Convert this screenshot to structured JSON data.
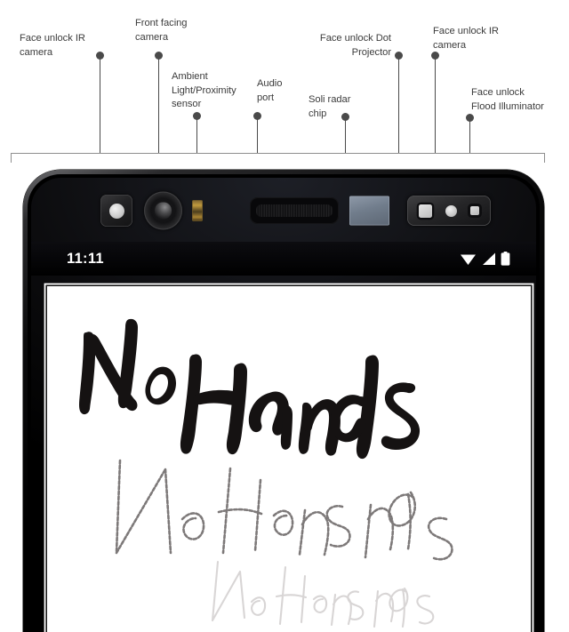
{
  "diagram": {
    "title": "Phone front sensor callout diagram",
    "text_color": "#3c3c3c",
    "leader_color": "#4a4a4a",
    "bracket_color": "#8e8e8e",
    "callouts": [
      {
        "id": "face-unlock-ir-camera-left",
        "label": "Face unlock IR\ncamera"
      },
      {
        "id": "front-facing-camera",
        "label": "Front facing\ncamera"
      },
      {
        "id": "ambient-light-proximity-sensor",
        "label": "Ambient\nLight/Proximity\nsensor"
      },
      {
        "id": "audio-port",
        "label": "Audio\nport"
      },
      {
        "id": "soli-radar-chip",
        "label": "Soli radar\nchip"
      },
      {
        "id": "face-unlock-dot-projector",
        "label": "Face unlock Dot\nProjector"
      },
      {
        "id": "face-unlock-ir-camera-right",
        "label": "Face unlock IR\ncamera"
      },
      {
        "id": "face-unlock-flood-illuminator",
        "label": "Face unlock\nFlood Illuminator"
      }
    ]
  },
  "phone": {
    "status_bar": {
      "time": "11:11",
      "wifi_icon": "wifi-icon",
      "signal_icon": "cell-signal-icon",
      "battery_icon": "battery-full-icon"
    },
    "screen": {
      "app_background": "#ffffff",
      "handwriting_text": "No Hands",
      "handwriting_layers": [
        {
          "name": "ink-stroke-primary",
          "text": "No Hands",
          "opacity": "1.00"
        },
        {
          "name": "ink-stroke-echo-1",
          "text": "No Hands",
          "opacity": "0.45"
        },
        {
          "name": "ink-stroke-echo-2",
          "text": "No Hands",
          "opacity": "0.16"
        }
      ]
    },
    "sensors": [
      {
        "id": "face-unlock-ir-camera-left",
        "type": "square-housing-white-lens"
      },
      {
        "id": "front-facing-camera",
        "type": "round-lens"
      },
      {
        "id": "ambient-light-proximity-sensor",
        "type": "amber-chip"
      },
      {
        "id": "audio-port",
        "type": "speaker-pill"
      },
      {
        "id": "soli-radar-chip",
        "type": "gray-rectangle"
      },
      {
        "id": "face-unlock-module",
        "type": "triple-module"
      }
    ]
  }
}
